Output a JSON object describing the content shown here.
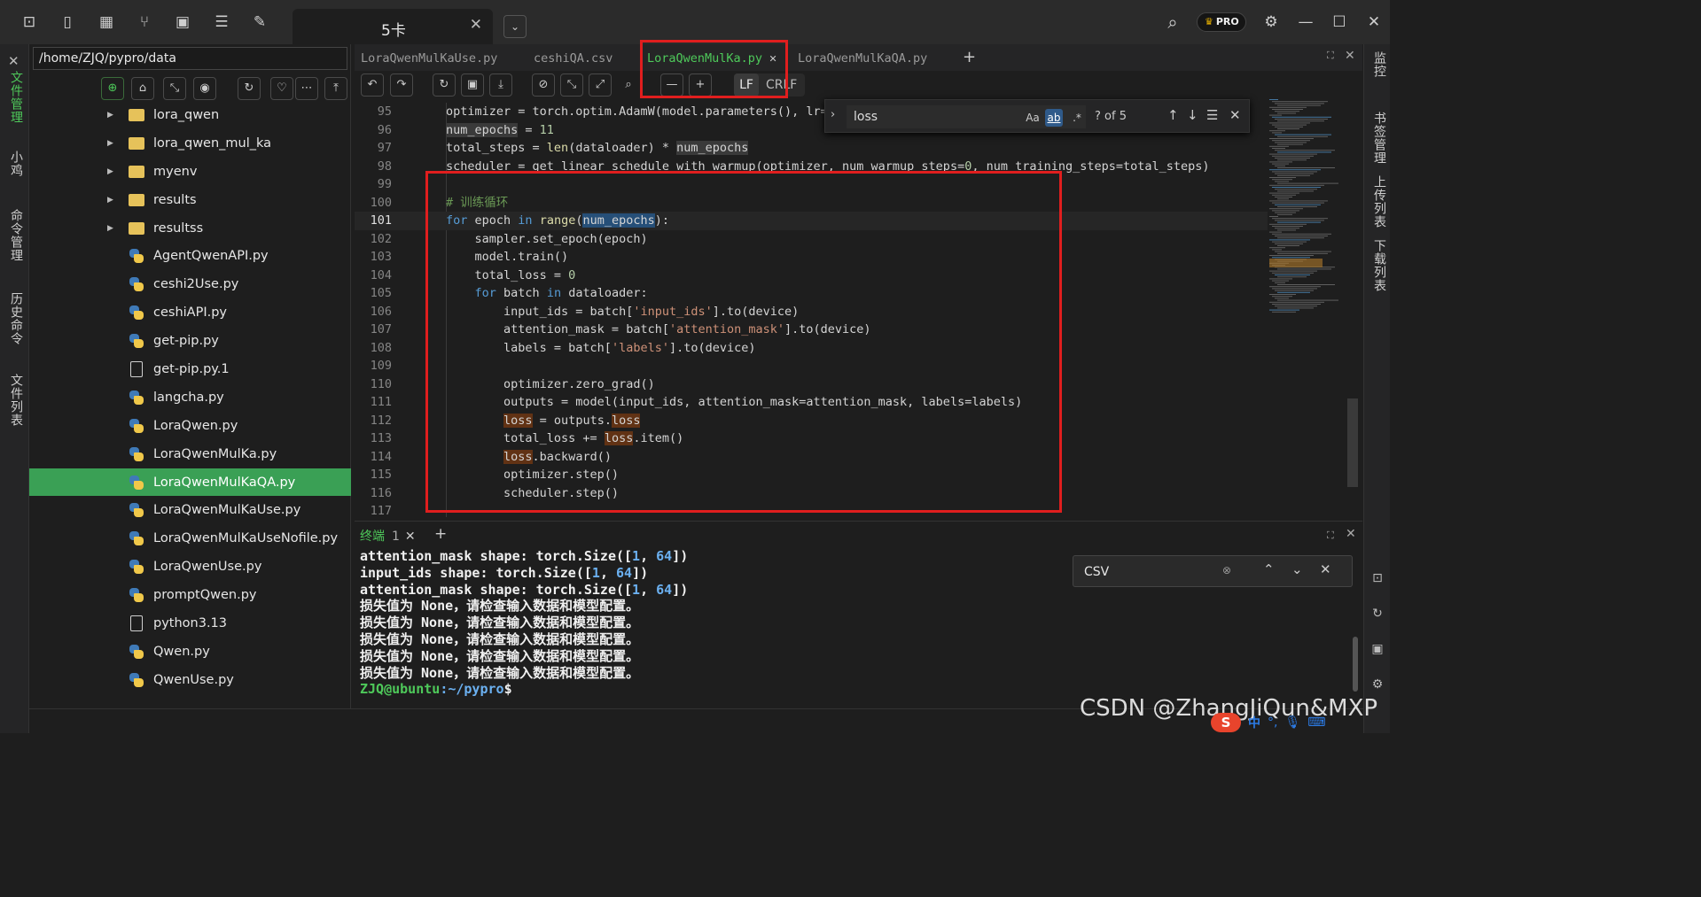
{
  "titlebar": {
    "session_title": "5卡",
    "pro_label": "PRO",
    "icons": [
      "terminal-icon",
      "file-icon",
      "layout-icon",
      "branch-icon",
      "console-icon",
      "list-icon",
      "wrench-icon"
    ]
  },
  "left_rail": {
    "items": [
      "文件管理",
      "小鸡",
      "命令管理",
      "历史命令",
      "文件列表"
    ]
  },
  "right_rail": {
    "items": [
      "监控",
      "书签管理",
      "上传列表",
      "下载列表"
    ]
  },
  "file_panel": {
    "path": "/home/ZJQ/pypro/data",
    "tree": [
      {
        "name": "lora_qwen",
        "type": "folder"
      },
      {
        "name": "lora_qwen_mul_ka",
        "type": "folder"
      },
      {
        "name": "myenv",
        "type": "folder"
      },
      {
        "name": "results",
        "type": "folder"
      },
      {
        "name": "resultss",
        "type": "folder"
      },
      {
        "name": "AgentQwenAPI.py",
        "type": "py"
      },
      {
        "name": "ceshi2Use.py",
        "type": "py"
      },
      {
        "name": "ceshiAPI.py",
        "type": "py"
      },
      {
        "name": "get-pip.py",
        "type": "py"
      },
      {
        "name": "get-pip.py.1",
        "type": "doc"
      },
      {
        "name": "langcha.py",
        "type": "py"
      },
      {
        "name": "LoraQwen.py",
        "type": "py"
      },
      {
        "name": "LoraQwenMulKa.py",
        "type": "py"
      },
      {
        "name": "LoraQwenMulKaQA.py",
        "type": "py",
        "selected": true
      },
      {
        "name": "LoraQwenMulKaUse.py",
        "type": "py"
      },
      {
        "name": "LoraQwenMulKaUseNofile.py",
        "type": "py"
      },
      {
        "name": "LoraQwenUse.py",
        "type": "py"
      },
      {
        "name": "promptQwen.py",
        "type": "py"
      },
      {
        "name": "python3.13",
        "type": "doc"
      },
      {
        "name": "Qwen.py",
        "type": "py"
      },
      {
        "name": "QwenUse.py",
        "type": "py"
      }
    ]
  },
  "editor": {
    "tabs": [
      {
        "label": "LoraQwenMulKaUse.py",
        "active": false
      },
      {
        "label": "ceshiQA.csv",
        "active": false
      },
      {
        "label": "LoraQwenMulKa.py",
        "active": true
      },
      {
        "label": "LoraQwenMulKaQA.py",
        "active": false
      }
    ],
    "eol_lf": "LF",
    "eol_crlf": "CRLF",
    "find": {
      "query": "loss",
      "case_label": "Aa",
      "word_label": "ab",
      "regex_label": ".*",
      "count": "? of 5"
    },
    "current_line": 101,
    "lines": [
      {
        "n": 95,
        "html": "optimizer = torch.optim.AdamW(model.parameters(), lr="
      },
      {
        "n": 96,
        "html": "<span class=\"hl3\">num_epochs</span> = <span class=\"nm\">11</span>"
      },
      {
        "n": 97,
        "html": "total_steps = <span class=\"fn\">len</span>(dataloader) * <span class=\"hl3\">num_epochs</span>"
      },
      {
        "n": 98,
        "html": "scheduler = get_linear_schedule_with_warmup(optimizer, num_warmup_steps=<span class=\"nm\">0</span>, num_training_steps=total_steps)"
      },
      {
        "n": 99,
        "html": ""
      },
      {
        "n": 100,
        "html": "<span class=\"cm\"># 训练循环</span>"
      },
      {
        "n": 101,
        "html": "<span class=\"kw\">for</span> epoch <span class=\"kw\">in</span> <span class=\"fn\">range</span>(<span class=\"hl2\">num_epochs</span>):"
      },
      {
        "n": 102,
        "html": "    sampler.set_epoch(epoch)"
      },
      {
        "n": 103,
        "html": "    model.train()"
      },
      {
        "n": 104,
        "html": "    total_loss = <span class=\"nm\">0</span>"
      },
      {
        "n": 105,
        "html": "    <span class=\"kw\">for</span> batch <span class=\"kw\">in</span> dataloader:"
      },
      {
        "n": 106,
        "html": "        input_ids = batch[<span class=\"st\">'input_ids'</span>].to(device)"
      },
      {
        "n": 107,
        "html": "        attention_mask = batch[<span class=\"st\">'attention_mask'</span>].to(device)"
      },
      {
        "n": 108,
        "html": "        labels = batch[<span class=\"st\">'labels'</span>].to(device)"
      },
      {
        "n": 109,
        "html": ""
      },
      {
        "n": 110,
        "html": "        optimizer.zero_grad()"
      },
      {
        "n": 111,
        "html": "        outputs = model(input_ids, attention_mask=attention_mask, labels=labels)"
      },
      {
        "n": 112,
        "html": "        <span class=\"hl\">loss</span> = outputs.<span class=\"hl\">loss</span>"
      },
      {
        "n": 113,
        "html": "        total_loss += <span class=\"hl\">loss</span>.item()"
      },
      {
        "n": 114,
        "html": "        <span class=\"hl\">loss</span>.backward()"
      },
      {
        "n": 115,
        "html": "        optimizer.step()"
      },
      {
        "n": 116,
        "html": "        scheduler.step()"
      },
      {
        "n": 117,
        "html": ""
      }
    ]
  },
  "terminal": {
    "tab_label": "终端",
    "tab_count": "1",
    "find_value": "CSV",
    "lines": [
      "attention_mask shape: torch.Size([<span class=\"tn\">1</span>, <span class=\"tn\">64</span>])",
      "input_ids shape: torch.Size([<span class=\"tn\">1</span>, <span class=\"tn\">64</span>])",
      "attention_mask shape: torch.Size([<span class=\"tn\">1</span>, <span class=\"tn\">64</span>])",
      "损失值为 None，请检查输入数据和模型配置。",
      "损失值为 None，请检查输入数据和模型配置。",
      "损失值为 None，请检查输入数据和模型配置。",
      "损失值为 None，请检查输入数据和模型配置。",
      "损失值为 None，请检查输入数据和模型配置。"
    ],
    "prompt_user": "ZJQ@ubuntu",
    "prompt_path": ":~/pypro",
    "prompt_sym": "$"
  },
  "watermark": "CSDN @ZhangJiQun&MXP",
  "ime": {
    "logo": "S",
    "lang": "中"
  }
}
